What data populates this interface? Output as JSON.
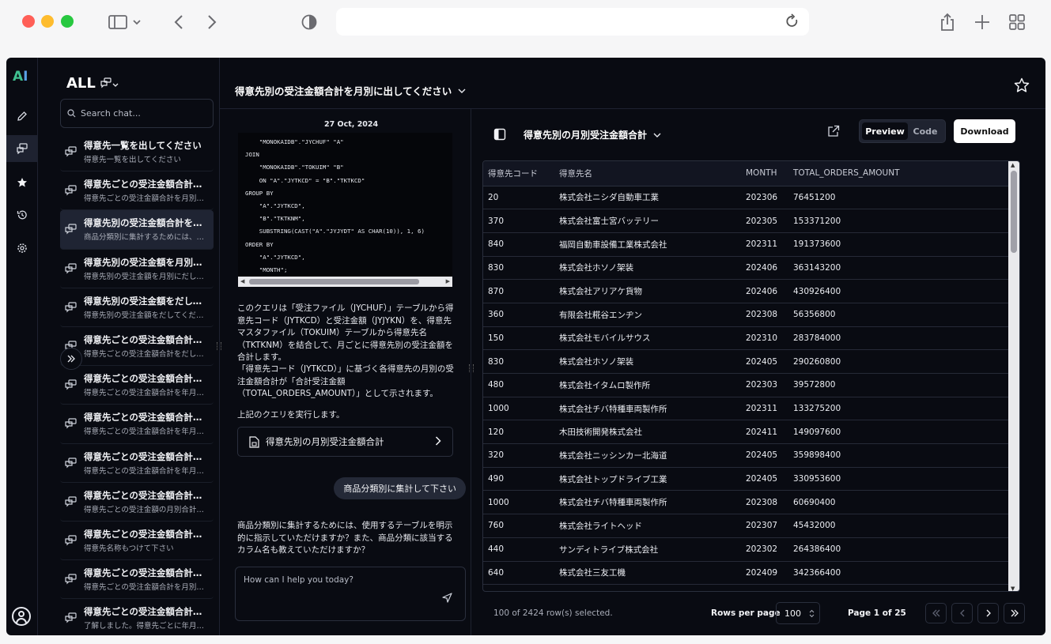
{
  "browser": {
    "url": ""
  },
  "rail": {
    "logo_a": "A",
    "logo_i": "I"
  },
  "sidebar": {
    "title": "ALL",
    "search_placeholder": "Search chat...",
    "items": [
      {
        "title": "得意先一覧を出してください",
        "subtitle": "得意先一覧を出してください",
        "active": false
      },
      {
        "title": "得意先ごとの受注金額合計を月...",
        "subtitle": "得意先ごとの受注金額合計を月別に出...",
        "active": false
      },
      {
        "title": "得意先別の受注金額合計を月...",
        "subtitle": "商品分類別に集計するためには、使用...",
        "active": true
      },
      {
        "title": "得意先別の受注金額を月別にだ...",
        "subtitle": "得意先別の受注金額を月別にだしてく...",
        "active": false
      },
      {
        "title": "得意先別の受注金額をだしてくだ...",
        "subtitle": "得意先別の受注金額をだしてください",
        "active": false
      },
      {
        "title": "得意先ごとの受注金額合計をだ...",
        "subtitle": "得意先ごとの受注金額合計をだしてく...",
        "active": false
      },
      {
        "title": "得意先ごとの受注金額合計を年...",
        "subtitle": "得意先ごとの受注金額合計を年月で集...",
        "active": false
      },
      {
        "title": "得意先ごとの受注金額合計を年...",
        "subtitle": "得意先ごとの受注金額合計を年月ごと...",
        "active": false
      },
      {
        "title": "得意先ごとの受注金額合計を年...",
        "subtitle": "得意先ごとの受注金額合計を年月別に...",
        "active": false
      },
      {
        "title": "得意先ごとの受注金額合計を月...",
        "subtitle": "得意先ごとの受注金額の月別合計を出...",
        "active": false
      },
      {
        "title": "得意先ごとの受注金額合計を月...",
        "subtitle": "得意先名称もつけて下さい",
        "active": false
      },
      {
        "title": "得意先ごとの受注金額合計を月...",
        "subtitle": "得意先ごとの受注金額合計を月別に出...",
        "active": false
      },
      {
        "title": "得意先ごとの受注金額合計を月...",
        "subtitle": "了解しました。得意先ごとに年月順にソ...",
        "active": false
      }
    ]
  },
  "header": {
    "title": "得意先別の受注金額合計を月別に出してください"
  },
  "chat": {
    "date": "27 Oct, 2024",
    "code": "    \"MONOKAIDB\".\"JYCHUF\" \"A\"\nJOIN\n    \"MONOKAIDB\".\"TOKUIM\" \"B\"\n    ON \"A\".\"JYTKCD\" = \"B\".\"TKTKCD\"\nGROUP BY\n    \"A\".\"JYTKCD\",\n    \"B\".\"TKTKNM\",\n    SUBSTRING(CAST(\"A\".\"JYJYDT\" AS CHAR(10)), 1, 6)\nORDER BY\n    \"A\".\"JYTKCD\",\n    \"MONTH\";",
    "para1": "このクエリは「受注ファイル（JYCHUF）」テーブルから得意先コード（JYTKCD）と受注金額（JYJYKN）を、得意先マスタファイル（TOKUIM）テーブルから得意先名（TKTKNM）を結合して、月ごとに得意先別の受注金額を合計します。",
    "para2": "「得意先コード（JYTKCD）」に基づく各得意先の月別の受注金額合計が「合計受注金額（TOTAL_ORDERS_AMOUNT）」として示されます。",
    "para3": "上記のクエリを実行します。",
    "query_button": "得意先別の月別受注金額合計",
    "user_message": "商品分類別に集計して下さい",
    "reply": "商品分類別に集計するためには、使用するテーブルを明示的に指示していただけますか？また、商品分類に該当するカラム名も教えていただけますか？",
    "input_placeholder": "How can I help you today?"
  },
  "data_panel": {
    "title": "得意先別の月別受注金額合計",
    "tab_preview": "Preview",
    "tab_code": "Code",
    "download": "Download",
    "columns": [
      "得意先コード",
      "得意先名",
      "MONTH",
      "TOTAL_ORDERS_AMOUNT"
    ],
    "rows": [
      [
        "20",
        "株式会社ニシダ自動車工業",
        "202306",
        "76451200"
      ],
      [
        "370",
        "株式会社富士宮バッテリー",
        "202305",
        "153371200"
      ],
      [
        "840",
        "福岡自動車設備工業株式会社",
        "202311",
        "191373600"
      ],
      [
        "830",
        "株式会社ホソノ架装",
        "202406",
        "363143200"
      ],
      [
        "870",
        "株式会社アリアケ貨物",
        "202406",
        "430926400"
      ],
      [
        "360",
        "有限会社糀谷エンヂン",
        "202308",
        "56356800"
      ],
      [
        "150",
        "株式会社モバイルサウス",
        "202310",
        "283784000"
      ],
      [
        "830",
        "株式会社ホソノ架装",
        "202405",
        "290260800"
      ],
      [
        "480",
        "株式会社イタムロ製作所",
        "202303",
        "39572800"
      ],
      [
        "1000",
        "株式会社チバ特種車両製作所",
        "202311",
        "133275200"
      ],
      [
        "120",
        "木田技術開発株式会社",
        "202411",
        "149097600"
      ],
      [
        "320",
        "株式会社ニッシンカー北海道",
        "202405",
        "359898400"
      ],
      [
        "490",
        "株式会社トップドライブ工業",
        "202405",
        "330953600"
      ],
      [
        "1000",
        "株式会社チバ特種車両製作所",
        "202308",
        "60690400"
      ],
      [
        "760",
        "株式会社ライトヘッド",
        "202307",
        "45432000"
      ],
      [
        "440",
        "サンディトライブ株式会社",
        "202302",
        "264386400"
      ],
      [
        "640",
        "株式会社三友工機",
        "202409",
        "342366400"
      ]
    ],
    "selection_text": "100 of 2424 row(s) selected.",
    "rows_per_page_label": "Rows per page",
    "rows_per_page_value": "100",
    "page_label": "Page 1 of 25"
  }
}
